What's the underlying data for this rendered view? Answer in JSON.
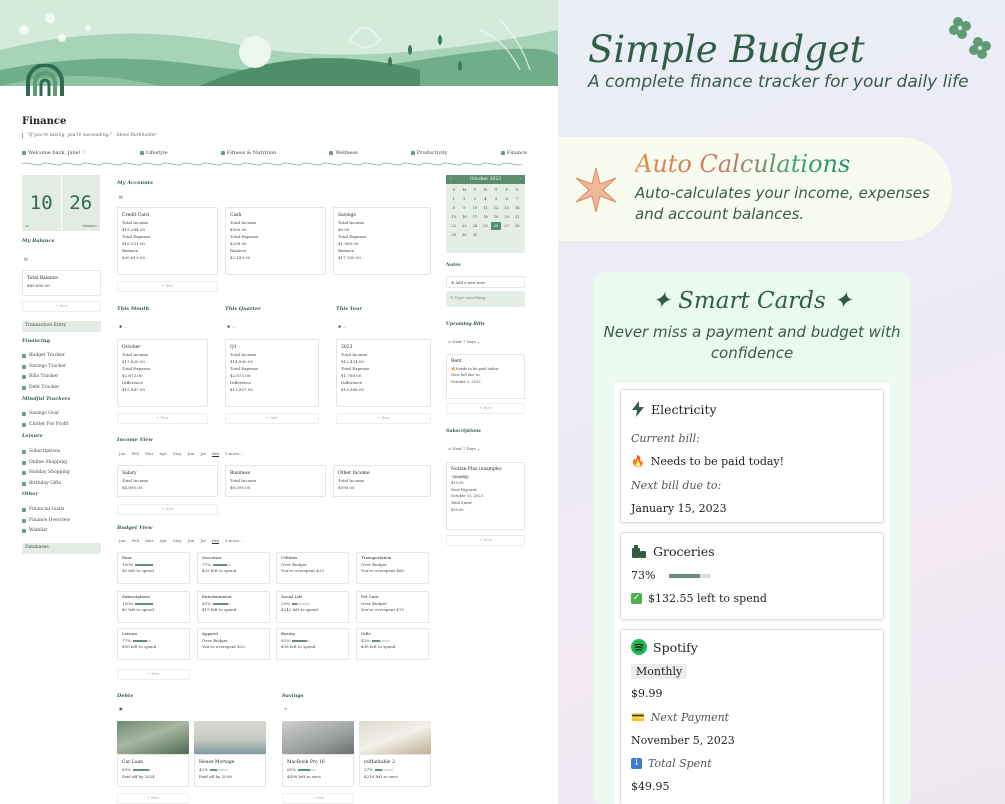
{
  "page": {
    "title": "Finance",
    "quote": "\"If you're saving, you're succeeding.\" - Steve Burkholder"
  },
  "nav": [
    "Welcome back, Jane! ♡",
    "Lifestyle",
    "Fitness & Nutrition",
    "Wellness",
    "Productivity",
    "Finance"
  ],
  "date_card": {
    "day1": "10",
    "day2": "26",
    "lab1": "10",
    "lab2": "THURSDAY"
  },
  "balance": {
    "title": "My Balance",
    "filter": "...",
    "card_title": "Total Balance",
    "card_value": "$49,885.00",
    "new": "+ New"
  },
  "transaction_entry": "Transaction Entry",
  "sidebar": {
    "financing_h": "Financing",
    "financing": [
      "Budget Tracker",
      "Savings Tracker",
      "Bills Tracker",
      "Debt Tracker"
    ],
    "mindful_h": "Mindful Trackers",
    "mindful": [
      "Savings Goal",
      "Clutter For Profit"
    ],
    "leisure_h": "Leisure",
    "leisure": [
      "Subscriptions",
      "Online Shopping",
      "Holiday Shopping",
      "Birthday Gifts"
    ],
    "other_h": "Other",
    "other": [
      "Financial Goals",
      "Finance Overview",
      "Wishlist"
    ],
    "databases": "Databases"
  },
  "accounts": {
    "title": "My Accounts",
    "cards": [
      {
        "name": "Credit Card",
        "l1": "Total Income",
        "v1": "$15,344.00",
        "l2": "Total Expense",
        "v2": "$16,331.00",
        "l3": "Balance",
        "v3": "$30,613.00"
      },
      {
        "name": "Cash",
        "l1": "Total Income",
        "v1": "$500.00",
        "l2": "Total Expense",
        "v2": "$298.00",
        "l3": "Balance",
        "v3": "$2,159.00"
      },
      {
        "name": "Savings",
        "l1": "Total Income",
        "v1": "$0.00",
        "l2": "Total Expense",
        "v2": "$1,900.00",
        "l3": "Balance",
        "v3": "$17,100.00"
      }
    ],
    "new": "+ New"
  },
  "periods": [
    {
      "title": "This Month",
      "name": "October",
      "v1": "$17,820.00",
      "v2": "$2,673.00",
      "v3": "$15,847.00"
    },
    {
      "title": "This Quarter",
      "name": "Q1",
      "v1": "$14,890.00",
      "v2": "$2,673.00",
      "v3": "$13,857.00"
    },
    {
      "title": "This Year",
      "name": "2023",
      "v1": "$12,434.00",
      "v2": "$1,766.00",
      "v3": "$19,568.00"
    }
  ],
  "period_labels": {
    "l1": "Total Income",
    "l2": "Total Expense",
    "l3": "Difference",
    "new": "+ New"
  },
  "months": [
    "Jan",
    "Feb",
    "Mar",
    "Apr",
    "May",
    "Jun",
    "Jul",
    "Oct",
    "5 more..."
  ],
  "income": {
    "title": "Income View",
    "cards": [
      {
        "name": "Salary",
        "l": "Total Income",
        "v": "$4,890.00"
      },
      {
        "name": "Business",
        "l": "Total Income",
        "v": "$6,590.00"
      },
      {
        "name": "Other Income",
        "l": "Total Income",
        "v": "$590.00"
      }
    ],
    "new": "+ New"
  },
  "budget": {
    "title": "Budget View",
    "cards": [
      {
        "name": "Rent",
        "pct": "100%",
        "fill": 1.0,
        "note": "$0 left to spend"
      },
      {
        "name": "Groceries",
        "pct": "77%",
        "fill": 0.77,
        "note": "$33 left to spend"
      },
      {
        "name": "Utilities",
        "pct": "Over Budget",
        "fill": 0,
        "note": "You're overspent $20"
      },
      {
        "name": "Transportation",
        "pct": "Over Budget",
        "fill": 0,
        "note": "You're overspent $60"
      },
      {
        "name": "Subscriptions",
        "pct": "100%",
        "fill": 1.0,
        "note": "$0 left to spend"
      },
      {
        "name": "Entertainment",
        "pct": "85%",
        "fill": 0.85,
        "note": "$15 left to spend"
      },
      {
        "name": "Social Life",
        "pct": "29%",
        "fill": 0.29,
        "note": "$242 left to spend"
      },
      {
        "name": "Pet Care",
        "pct": "Over Budget",
        "fill": 0,
        "note": "You're overspent $70"
      },
      {
        "name": "Leisure",
        "pct": "77%",
        "fill": 0.77,
        "note": "$50 left to spend"
      },
      {
        "name": "Apparel",
        "pct": "Over Budget",
        "fill": 0,
        "note": "You're overspent $20"
      },
      {
        "name": "Beauty",
        "pct": "83%",
        "fill": 0.83,
        "note": "$38 left to spend"
      },
      {
        "name": "Gifts",
        "pct": "43%",
        "fill": 0.43,
        "note": "$38 left to spend"
      }
    ],
    "new": "+ New"
  },
  "debts": {
    "title": "Debts",
    "cards": [
      {
        "name": "Car Loan",
        "pct": "89%",
        "fill": 0.89,
        "note": "Paid off by 2024"
      },
      {
        "name": "House Mortage",
        "pct": "42%",
        "fill": 0.42,
        "note": "Paid off by 2038"
      }
    ],
    "new": "+ New"
  },
  "savings": {
    "title": "Savings",
    "cards": [
      {
        "name": "MacBook Pro 16",
        "pct": "65%",
        "fill": 0.65,
        "note": "$498 left to save"
      },
      {
        "name": "reMarkable 2",
        "pct": "37%",
        "fill": 0.37,
        "note": "$218 left to save"
      }
    ],
    "new": "+ New"
  },
  "calendar": {
    "month": "October 2023",
    "dows": [
      "S",
      "M",
      "T",
      "W",
      "T",
      "F",
      "S"
    ],
    "days": [
      "1",
      "2",
      "3",
      "4",
      "5",
      "6",
      "7",
      "8",
      "9",
      "10",
      "11",
      "12",
      "13",
      "14",
      "15",
      "16",
      "17",
      "18",
      "19",
      "20",
      "21",
      "22",
      "23",
      "24",
      "25",
      "26",
      "27",
      "28",
      "29",
      "30",
      "31",
      "",
      "",
      "",
      ""
    ],
    "selected": "26"
  },
  "notes": {
    "title": "Notes",
    "add": "Add a new note",
    "placeholder": "Type something..."
  },
  "upcoming": {
    "title": "Upcoming Bills",
    "filter": "Next 7 Days",
    "name": "Rent",
    "tag": "Needs to be paid today!",
    "due_l": "Next bill due to:",
    "due": "October 2, 2023",
    "new": "+ New"
  },
  "subs": {
    "title": "Subscriptions",
    "filter": "Next 7 Days",
    "name": "Notion Plus (example)",
    "freq": "Monthly",
    "price": "$10.00",
    "np_l": "Next Payment",
    "np": "October 13, 2023",
    "ts_l": "Total Spent",
    "ts": "$20.00",
    "new": "+ New"
  },
  "hero": {
    "title": "Simple Budget",
    "subtitle": "A complete finance tracker for your daily life",
    "auto_title": "Auto Calculations",
    "auto_desc": "Auto-calculates your income, expenses and account balances.",
    "smart_title": "✦ Smart Cards ✦",
    "smart_desc": "Never miss a payment and budget with confidence"
  },
  "cards": {
    "electricity": {
      "title": "Electricity",
      "current": "Current bill:",
      "status": "Needs to be paid today!",
      "due_label": "Next bill due to:",
      "due": "January 15, 2023"
    },
    "groceries": {
      "title": "Groceries",
      "pct": "73%",
      "fill": 0.73,
      "left": "$132.55 left to spend"
    },
    "spotify": {
      "title": "Spotify",
      "freq": "Monthly",
      "price": "$9.99",
      "np_label": "Next Payment",
      "np": "November 5, 2023",
      "ts_label": "Total Spent",
      "ts": "$49.95"
    }
  },
  "colors": {
    "accent": "#2f5e44",
    "green": "#5c8d6e",
    "cal_bg": "#e4ede6"
  }
}
